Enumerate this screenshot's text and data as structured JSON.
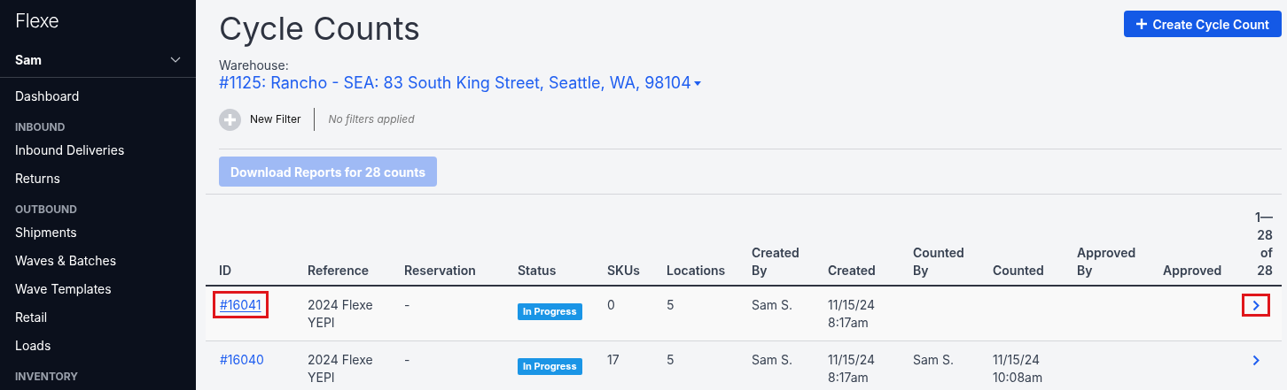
{
  "sidebar": {
    "logo": "Flexe",
    "user": {
      "name": "Sam",
      "expanded": false
    },
    "items": [
      {
        "kind": "link",
        "label": "Dashboard"
      },
      {
        "kind": "section",
        "label": "INBOUND"
      },
      {
        "kind": "link",
        "label": "Inbound Deliveries"
      },
      {
        "kind": "link",
        "label": "Returns"
      },
      {
        "kind": "section",
        "label": "OUTBOUND"
      },
      {
        "kind": "link",
        "label": "Shipments"
      },
      {
        "kind": "link",
        "label": "Waves & Batches"
      },
      {
        "kind": "link",
        "label": "Wave Templates"
      },
      {
        "kind": "link",
        "label": "Retail"
      },
      {
        "kind": "link",
        "label": "Loads"
      },
      {
        "kind": "section",
        "label": "INVENTORY"
      }
    ]
  },
  "page": {
    "title": "Cycle Counts",
    "create_button": "Create Cycle Count",
    "warehouse_label": "Warehouse:",
    "warehouse": "#1125: Rancho - SEA: 83 South King Street, Seattle, WA, 98104",
    "filter": {
      "button": "New Filter",
      "status": "No filters applied"
    },
    "download_button": {
      "label": "Download Reports for 28 counts",
      "disabled": true
    }
  },
  "table": {
    "columns": [
      "ID",
      "Reference",
      "Reservation",
      "Status",
      "SKUs",
      "Locations",
      "Created By",
      "Created",
      "Counted By",
      "Counted",
      "Approved By",
      "Approved"
    ],
    "pager": "1—28 of 28",
    "rows": [
      {
        "id": "#16041",
        "reference": "2024 Flexe YEPI",
        "reservation": "-",
        "status": "In Progress",
        "skus": "0",
        "locations": "5",
        "created_by": "Sam S.",
        "created": "11/15/24 8:17am",
        "counted_by": "",
        "counted": "",
        "approved_by": "",
        "approved": "",
        "highlighted": true
      },
      {
        "id": "#16040",
        "reference": "2024 Flexe YEPI",
        "reservation": "-",
        "status": "In Progress",
        "skus": "17",
        "locations": "5",
        "created_by": "Sam S.",
        "created": "11/15/24 8:17am",
        "counted_by": "Sam S.",
        "counted": "11/15/24 10:08am",
        "approved_by": "",
        "approved": "",
        "highlighted": false
      }
    ]
  }
}
